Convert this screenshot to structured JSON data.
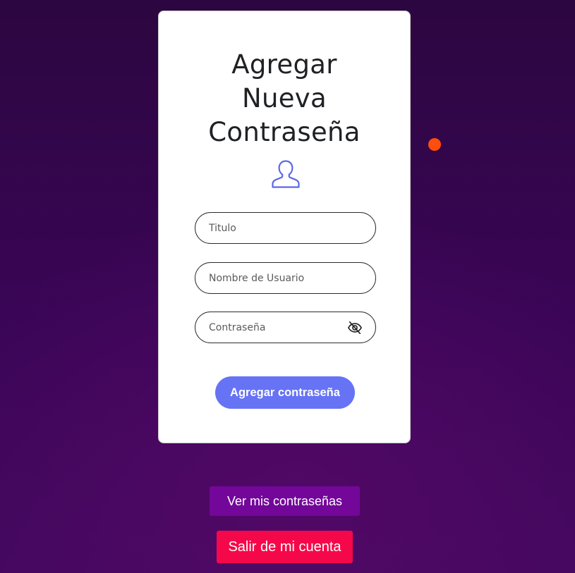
{
  "card": {
    "title_lines": [
      "Agregar",
      "Nueva",
      "Contraseña"
    ],
    "avatar_icon": "user-outline-icon",
    "fields": {
      "title_placeholder": "Titulo",
      "username_placeholder": "Nombre de Usuario",
      "password_placeholder": "Contraseña",
      "password_toggle_icon": "eye-slash-icon"
    },
    "submit_label": "Agregar contraseña"
  },
  "actions": {
    "view_label": "Ver mis contraseñas",
    "logout_label": "Salir de mi cuenta"
  },
  "colors": {
    "background": "#3a0556",
    "accent": "#6673f5",
    "view_button": "#730799",
    "logout_button": "#f5084a",
    "indicator_dot": "#ff4d0d"
  }
}
